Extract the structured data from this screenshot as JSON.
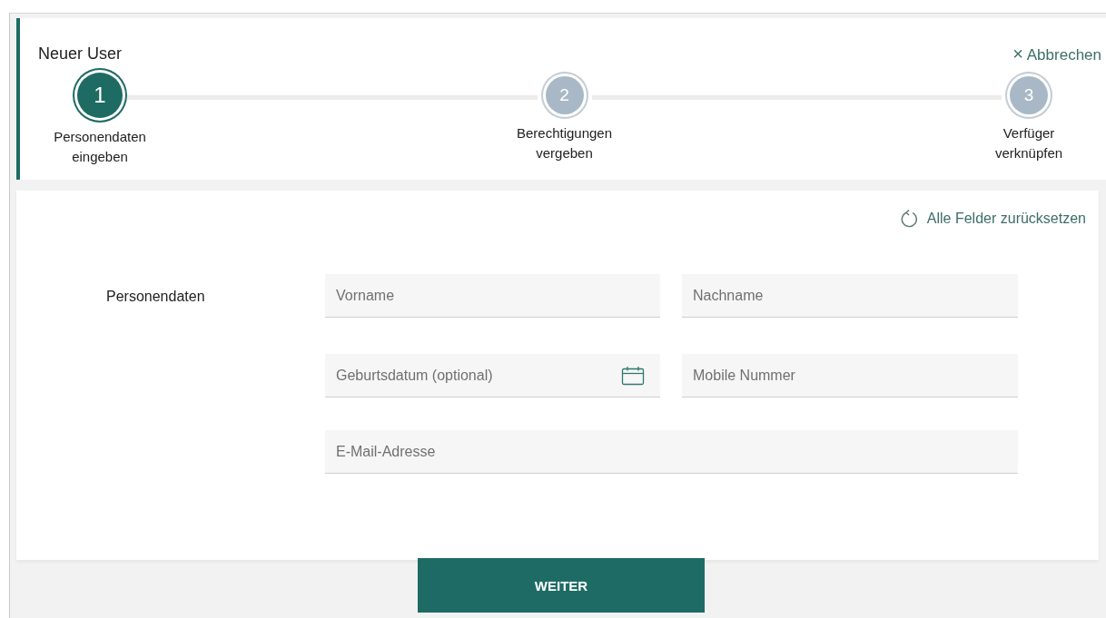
{
  "header": {
    "title": "Neuer User",
    "cancel": {
      "icon": "×",
      "label": "Abbrechen"
    }
  },
  "steps": [
    {
      "number": "1",
      "label": "Personendaten eingeben",
      "selected": true
    },
    {
      "number": "2",
      "label": "Berechtigungen vergeben",
      "selected": false
    },
    {
      "number": "3",
      "label": "Verfüger verknüpfen",
      "selected": false
    }
  ],
  "reset_link": "Alle Felder zurücksetzen",
  "section_label": "Personendaten",
  "fields": [
    {
      "placeholder": "Vorname",
      "kind": "text"
    },
    {
      "placeholder": "Nachname",
      "kind": "text"
    },
    {
      "placeholder": "Geburtsdatum (optional)",
      "kind": "date"
    },
    {
      "placeholder": "Mobile Nummer",
      "kind": "text"
    },
    {
      "placeholder": "E-Mail-Adresse",
      "kind": "wide"
    }
  ],
  "submit_button": "WEITER"
}
